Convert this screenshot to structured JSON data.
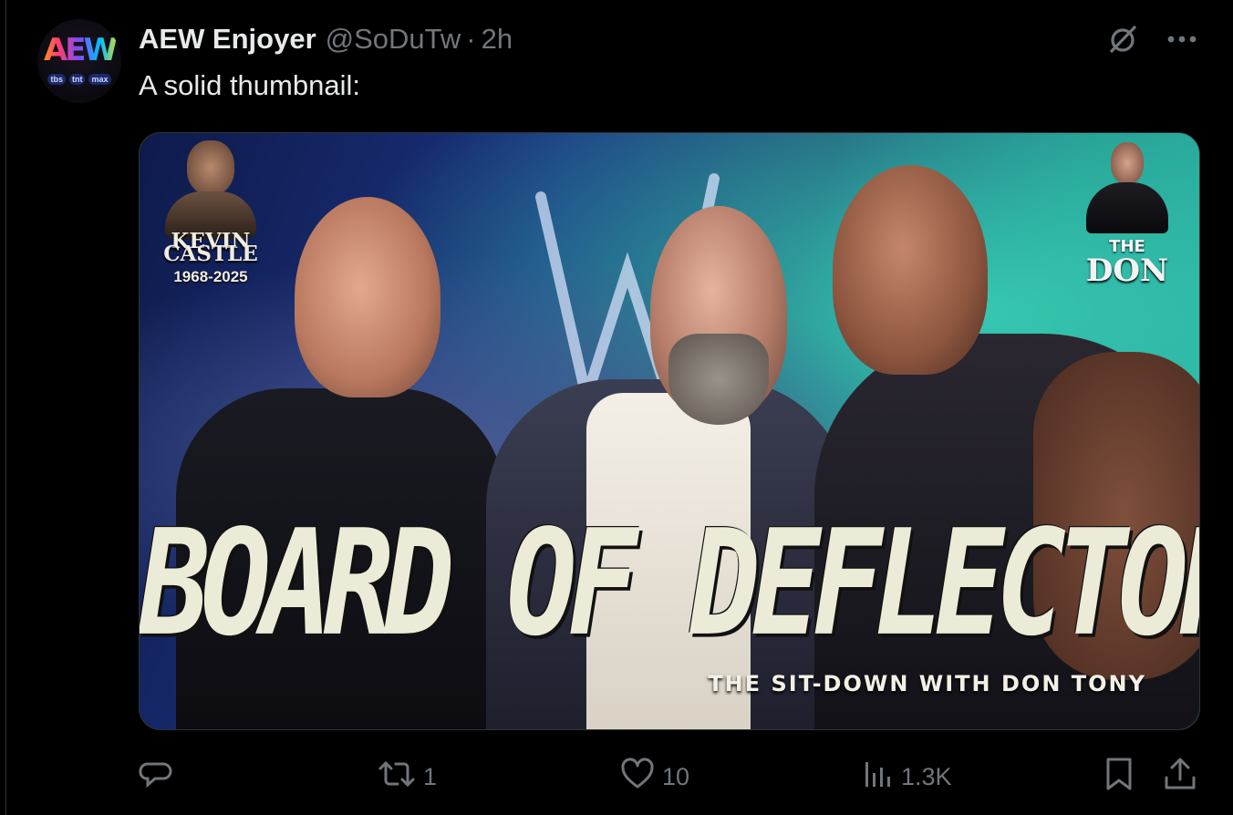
{
  "author": {
    "display_name": "AEW Enjoyer",
    "handle": "@SoDuTw",
    "separator": "·",
    "time": "2h",
    "avatar": {
      "logo_text": "AEW",
      "networks": [
        "tbs",
        "tnt",
        "max"
      ]
    }
  },
  "tweet": {
    "text": "A solid thumbnail:"
  },
  "media": {
    "headline": "BOARD OF DEFLECTORS",
    "subhead": "THE SIT-DOWN WITH DON TONY",
    "memorial": {
      "name_line1": "KEVIN",
      "name_line2": "CASTLE",
      "years": "1968-2025"
    },
    "brand": {
      "line1": "THE",
      "line2": "DON"
    }
  },
  "actions": {
    "replies": "",
    "reposts": "1",
    "likes": "10",
    "views": "1.3K"
  },
  "icons": {
    "grok": "grok-slash-icon",
    "more": "more-icon",
    "reply": "reply-icon",
    "repost": "repost-icon",
    "like": "heart-icon",
    "views": "views-icon",
    "bookmark": "bookmark-icon",
    "share": "share-icon"
  },
  "colors": {
    "background": "#000000",
    "text": "#e7e9ea",
    "muted": "#71767b"
  }
}
